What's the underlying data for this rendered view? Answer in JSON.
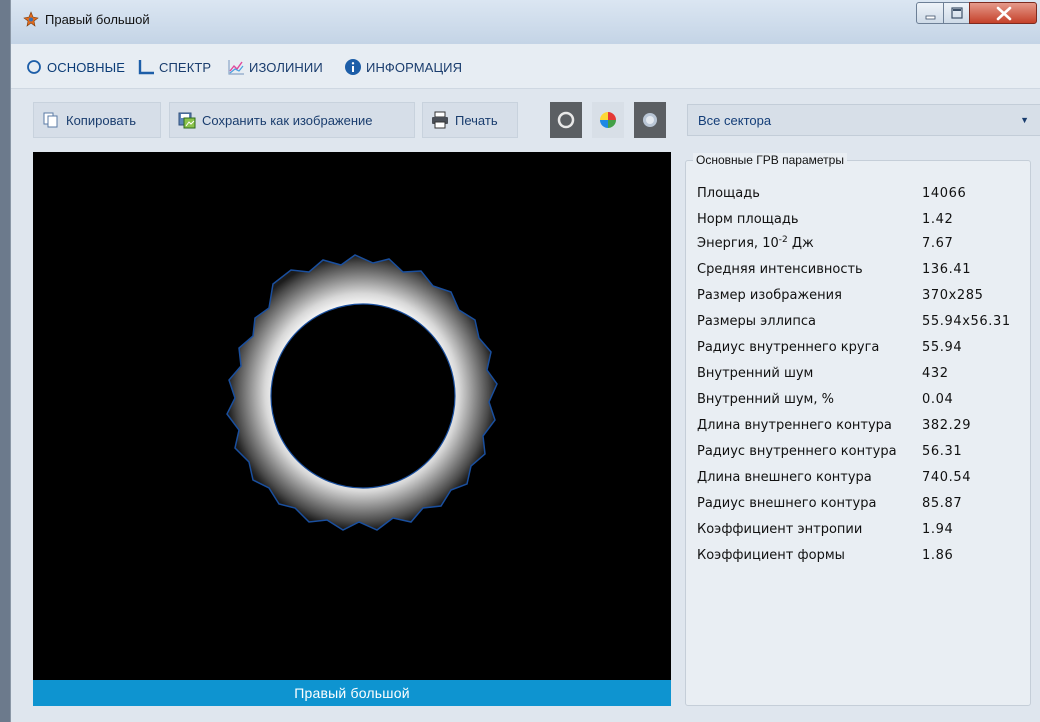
{
  "window": {
    "title": "Правый большой"
  },
  "tabs": [
    {
      "label": "ОСНОВНЫЕ",
      "icon": "circle-outline-icon",
      "active": true
    },
    {
      "label": "СПЕКТР",
      "icon": "chart-axis-icon",
      "active": false
    },
    {
      "label": "ИЗОЛИНИИ",
      "icon": "line-chart-icon",
      "active": false
    },
    {
      "label": "ИНФОРМАЦИЯ",
      "icon": "info-icon",
      "active": false
    }
  ],
  "toolbar": {
    "copy_label": "Копировать",
    "save_label": "Сохранить как изображение",
    "print_label": "Печать"
  },
  "view_modes": [
    "ring-view-icon",
    "color-pie-icon",
    "blob-view-icon"
  ],
  "sector_select": {
    "value": "Все сектора"
  },
  "image": {
    "caption": "Правый большой"
  },
  "params": {
    "legend": "Основные ГРВ параметры",
    "rows": [
      {
        "label": "Площадь",
        "value": "14066"
      },
      {
        "label": "Норм площадь",
        "value": "1.42"
      },
      {
        "label_prefix": "Энергия, 10",
        "label_sup": "-2",
        "label_suffix": " Дж",
        "value": "7.67"
      },
      {
        "label": "Средняя интенсивность",
        "value": "136.41"
      },
      {
        "label": "Размер изображения",
        "value": "370x285"
      },
      {
        "label": "Размеры эллипса",
        "value": "55.94x56.31"
      },
      {
        "label": "Радиус внутреннего круга",
        "value": "55.94"
      },
      {
        "label": "Внутренний шум",
        "value": "432"
      },
      {
        "label": "Внутренний шум, %",
        "value": "0.04"
      },
      {
        "label": "Длина внутреннего контура",
        "value": "382.29"
      },
      {
        "label": "Радиус внутреннего контура",
        "value": "56.31"
      },
      {
        "label": "Длина внешнего контура",
        "value": "740.54"
      },
      {
        "label": "Радиус внешнего контура",
        "value": "85.87"
      },
      {
        "label": "Коэффициент энтропии",
        "value": "1.94"
      },
      {
        "label": "Коэффициент формы",
        "value": "1.86"
      }
    ]
  },
  "colors": {
    "accent": "#0e94d0",
    "tab_text": "#1a3d6e",
    "close_button": "#c5412a"
  }
}
